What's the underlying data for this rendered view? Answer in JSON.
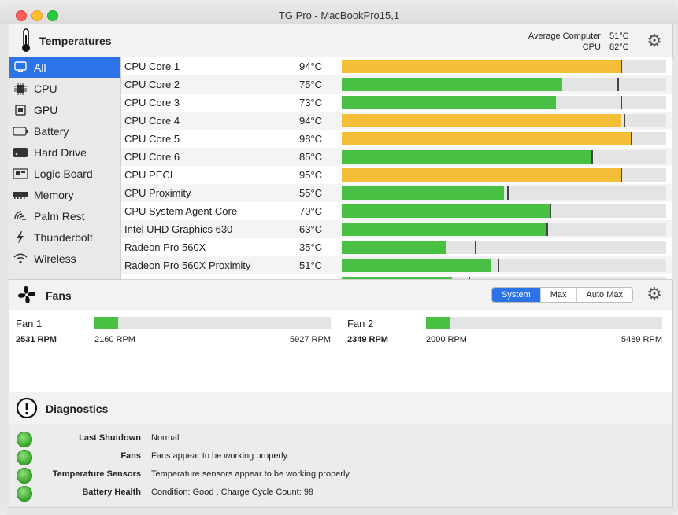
{
  "window": {
    "title": "TG Pro - MacBookPro15,1"
  },
  "temperatures": {
    "title": "Temperatures",
    "average_label": "Average Computer:",
    "average_value": "51°C",
    "cpu_label": "CPU:",
    "cpu_value": "82°C",
    "sidebar": [
      {
        "label": "All",
        "icon": "computer-icon",
        "selected": true
      },
      {
        "label": "CPU",
        "icon": "cpu-icon"
      },
      {
        "label": "GPU",
        "icon": "gpu-icon"
      },
      {
        "label": "Battery",
        "icon": "battery-icon"
      },
      {
        "label": "Hard Drive",
        "icon": "hard-drive-icon"
      },
      {
        "label": "Logic Board",
        "icon": "logic-board-icon"
      },
      {
        "label": "Memory",
        "icon": "memory-icon"
      },
      {
        "label": "Palm Rest",
        "icon": "palm-rest-icon"
      },
      {
        "label": "Thunderbolt",
        "icon": "thunderbolt-icon"
      },
      {
        "label": "Wireless",
        "icon": "wireless-icon"
      }
    ],
    "rows": [
      {
        "name": "CPU Core 1",
        "value": "94°C",
        "level": 0.86,
        "max_marker": 0.86,
        "color": "#f4bf38"
      },
      {
        "name": "CPU Core 2",
        "value": "75°C",
        "level": 0.68,
        "max_marker": 0.85,
        "color": "#48c043"
      },
      {
        "name": "CPU Core 3",
        "value": "73°C",
        "level": 0.66,
        "max_marker": 0.86,
        "color": "#48c043"
      },
      {
        "name": "CPU Core 4",
        "value": "94°C",
        "level": 0.86,
        "max_marker": 0.87,
        "color": "#f4bf38"
      },
      {
        "name": "CPU Core 5",
        "value": "98°C",
        "level": 0.89,
        "max_marker": 0.89,
        "color": "#f4bf38"
      },
      {
        "name": "CPU Core 6",
        "value": "85°C",
        "level": 0.77,
        "max_marker": 0.77,
        "color": "#48c043"
      },
      {
        "name": "CPU PECI",
        "value": "95°C",
        "level": 0.86,
        "max_marker": 0.86,
        "color": "#f4bf38"
      },
      {
        "name": "CPU Proximity",
        "value": "55°C",
        "level": 0.5,
        "max_marker": 0.51,
        "color": "#48c043"
      },
      {
        "name": "CPU System Agent Core",
        "value": "70°C",
        "level": 0.64,
        "max_marker": 0.64,
        "color": "#48c043"
      },
      {
        "name": "Intel UHD Graphics 630",
        "value": "63°C",
        "level": 0.63,
        "max_marker": 0.63,
        "color": "#48c043"
      },
      {
        "name": "Radeon Pro 560X",
        "value": "35°C",
        "level": 0.32,
        "max_marker": 0.41,
        "color": "#48c043"
      },
      {
        "name": "Radeon Pro 560X Proximity",
        "value": "51°C",
        "level": 0.46,
        "max_marker": 0.48,
        "color": "#48c043"
      },
      {
        "name": "",
        "value": "",
        "level": 0.34,
        "max_marker": 0.39,
        "color": "#48c043"
      }
    ]
  },
  "fans": {
    "title": "Fans",
    "modes": [
      "System",
      "Max",
      "Auto Max"
    ],
    "active_mode": "System",
    "items": [
      {
        "name": "Fan 1",
        "rpm": "2531 RPM",
        "min": "2160 RPM",
        "max": "5927 RPM",
        "level": 0.1
      },
      {
        "name": "Fan 2",
        "rpm": "2349 RPM",
        "min": "2000 RPM",
        "max": "5489 RPM",
        "level": 0.1
      }
    ]
  },
  "diagnostics": {
    "title": "Diagnostics",
    "items": [
      {
        "label": "Last Shutdown",
        "value": "Normal"
      },
      {
        "label": "Fans",
        "value": "Fans appear to be working properly."
      },
      {
        "label": "Temperature Sensors",
        "value": "Temperature sensors appear to be working properly."
      },
      {
        "label": "Battery Health",
        "value": "Condition: Good , Charge Cycle Count: 99"
      }
    ]
  }
}
